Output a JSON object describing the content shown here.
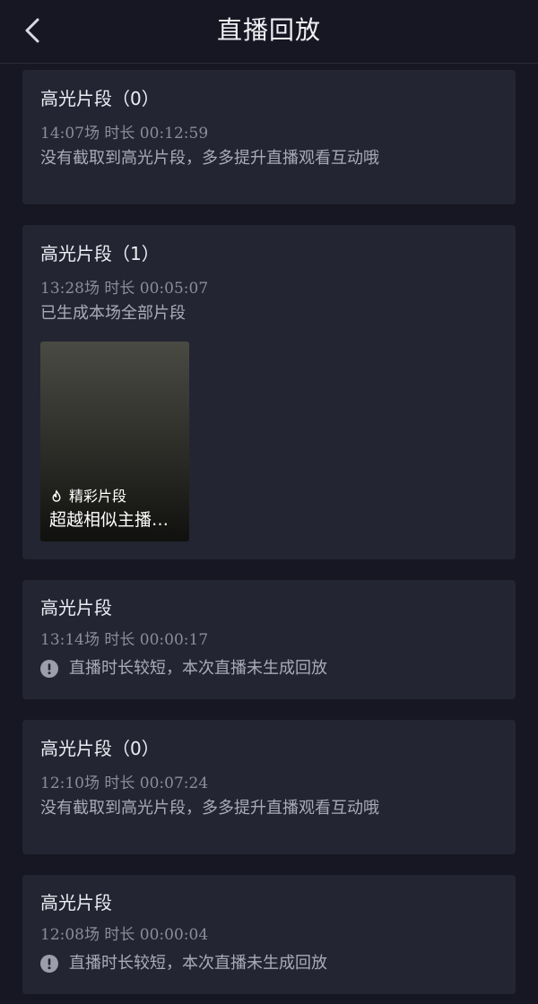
{
  "header": {
    "title": "直播回放",
    "back_icon": "chevron-left-icon"
  },
  "cards": [
    {
      "title": "高光片段（0）",
      "meta": "14:07场 时长 00:12:59",
      "desc": "没有截取到高光片段，多多提升直播观看互动哦"
    },
    {
      "title": "高光片段（1）",
      "meta": "13:28场 时长 00:05:07",
      "desc": "已生成本场全部片段",
      "clip": {
        "tag_icon": "fire-icon",
        "tag": "精彩片段",
        "caption": "超越相似主播…"
      }
    },
    {
      "title": "高光片段",
      "meta": "13:14场 时长 00:00:17",
      "notice_icon": "warning-icon",
      "notice": "直播时长较短，本次直播未生成回放"
    },
    {
      "title": "高光片段（0）",
      "meta": "12:10场 时长 00:07:24",
      "desc": "没有截取到高光片段，多多提升直播观看互动哦"
    },
    {
      "title": "高光片段",
      "meta": "12:08场 时长 00:00:04",
      "notice_icon": "warning-icon",
      "notice": "直播时长较短，本次直播未生成回放"
    }
  ],
  "colors": {
    "background": "#161722",
    "card": "#232532",
    "title_text": "#eceef5",
    "meta_text": "#8b8d9c",
    "desc_text": "#a9abba"
  }
}
